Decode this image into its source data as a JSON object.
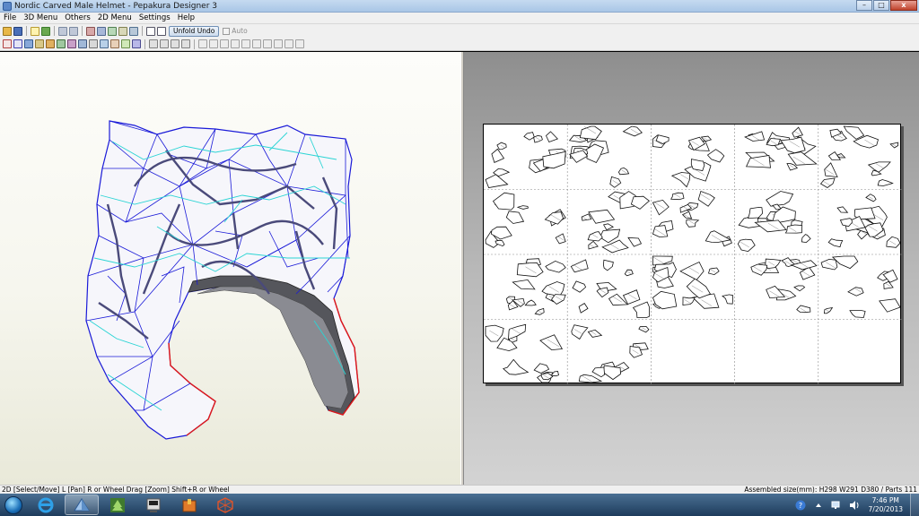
{
  "window": {
    "title": "Nordic Carved Male Helmet - Pepakura Designer 3",
    "icon": "pepakura-app-icon",
    "buttons": {
      "minimize": "–",
      "maximize": "□",
      "close": "x"
    }
  },
  "menu": {
    "items": [
      "File",
      "3D Menu",
      "Others",
      "2D Menu",
      "Settings",
      "Help"
    ]
  },
  "toolbar1": {
    "unfold_undo_label": "Unfold Undo",
    "auto_label": "Auto",
    "auto_checked": true
  },
  "status": {
    "left": "2D [Select/Move] L [Pan] R or Wheel Drag [Zoom] Shift+R or Wheel",
    "right": "Assembled size(mm): H298 W291 D380 / Parts 111"
  },
  "taskbar": {
    "apps": [
      "internet-explorer-icon",
      "pepakura-icon",
      "tree-app-icon",
      "computer-icon",
      "package-icon",
      "cube-app-icon"
    ],
    "active_app": "pepakura-icon",
    "clock_time": "7:46 PM",
    "clock_date": "7/20/2013"
  },
  "colors": {
    "viewport_bg_top": "#fdfdfa",
    "viewport_bg_bottom": "#e9e9d9",
    "mesh_edge": "#1a1ad8",
    "mesh_fold": "#2ad4d4",
    "mesh_cut": "#e01818",
    "paper_bg": "#ffffff"
  },
  "layout_sheet": {
    "rows": 4,
    "cols": 5,
    "filled_pages": 17
  }
}
